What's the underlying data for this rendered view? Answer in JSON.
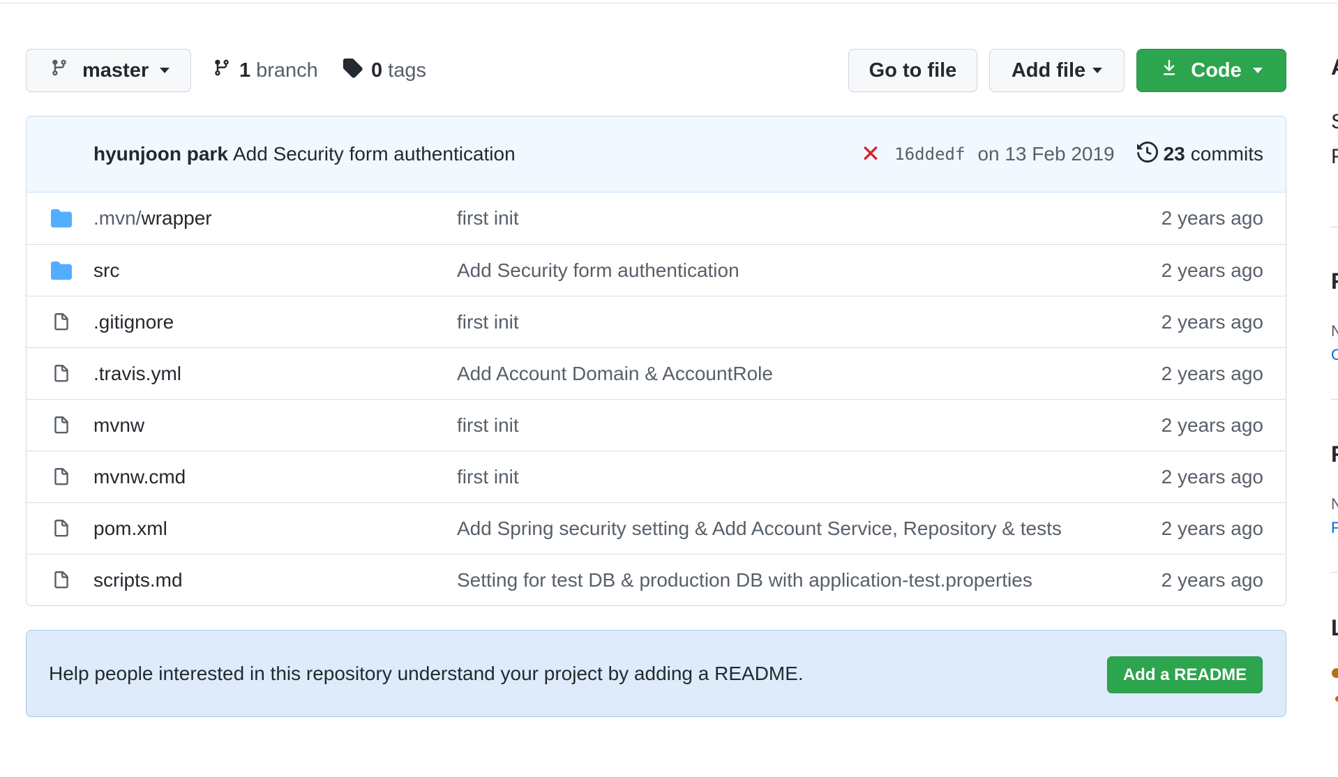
{
  "toolbar": {
    "branch": "master",
    "branch_count": "1",
    "branch_label": "branch",
    "tag_count": "0",
    "tag_label": "tags",
    "go_to_file": "Go to file",
    "add_file": "Add file",
    "code": "Code"
  },
  "latest_commit": {
    "author": "hyunjoon park",
    "message": "Add Security form authentication",
    "status": "✕",
    "sha": "16ddedf",
    "date": "on 13 Feb 2019",
    "commit_count": "23",
    "commit_label": "commits"
  },
  "files": [
    {
      "type": "folder",
      "prefix": ".mvn/",
      "name": "wrapper",
      "message": "first init",
      "age": "2 years ago"
    },
    {
      "type": "folder",
      "prefix": "",
      "name": "src",
      "message": "Add Security form authentication",
      "age": "2 years ago"
    },
    {
      "type": "file",
      "prefix": "",
      "name": ".gitignore",
      "message": "first init",
      "age": "2 years ago"
    },
    {
      "type": "file",
      "prefix": "",
      "name": ".travis.yml",
      "message": "Add Account Domain & AccountRole",
      "age": "2 years ago"
    },
    {
      "type": "file",
      "prefix": "",
      "name": "mvnw",
      "message": "first init",
      "age": "2 years ago"
    },
    {
      "type": "file",
      "prefix": "",
      "name": "mvnw.cmd",
      "message": "first init",
      "age": "2 years ago"
    },
    {
      "type": "file",
      "prefix": "",
      "name": "pom.xml",
      "message": "Add Spring security setting & Add Account Service, Repository & tests",
      "age": "2 years ago"
    },
    {
      "type": "file",
      "prefix": "",
      "name": "scripts.md",
      "message": "Setting for test DB & production DB with application-test.properties",
      "age": "2 years ago"
    }
  ],
  "readme_prompt": {
    "text": "Help people interested in this repository understand your project by adding a README.",
    "button": "Add a README"
  },
  "sidebar_clipped": {
    "letters": [
      "A",
      "S",
      "F",
      "F",
      "N",
      "C",
      "F",
      "N",
      "F",
      "L"
    ]
  },
  "colors": {
    "accent_green": "#2da44e",
    "folder_blue": "#54aeff",
    "status_red": "#cf222e",
    "commit_header_bg": "#f1f8ff",
    "readme_bg": "#ddebfb"
  }
}
